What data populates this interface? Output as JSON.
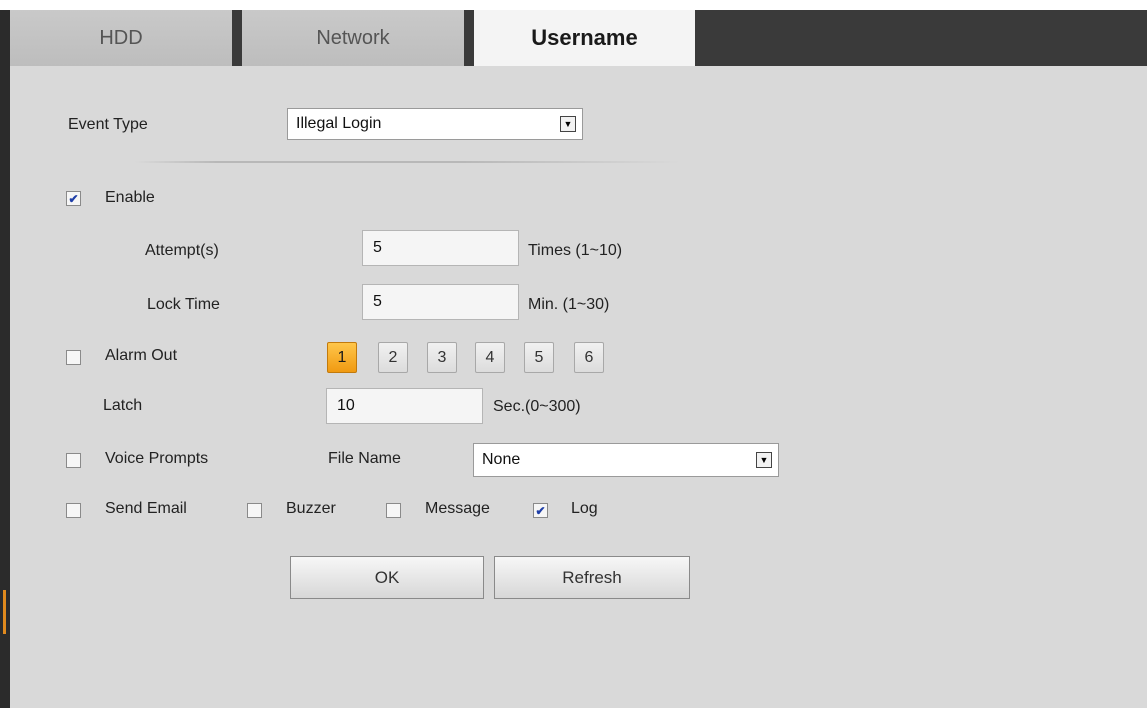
{
  "tabs": [
    {
      "label": "HDD",
      "active": false
    },
    {
      "label": "Network",
      "active": false
    },
    {
      "label": "Username",
      "active": true
    }
  ],
  "event_type": {
    "label": "Event Type",
    "value": "Illegal Login"
  },
  "enable": {
    "label": "Enable",
    "checked": true
  },
  "attempts": {
    "label": "Attempt(s)",
    "value": "5",
    "unit": "Times (1~10)"
  },
  "lock_time": {
    "label": "Lock Time",
    "value": "5",
    "unit": "Min. (1~30)"
  },
  "alarm_out": {
    "label": "Alarm Out",
    "checked": false,
    "channels": [
      "1",
      "2",
      "3",
      "4",
      "5",
      "6"
    ],
    "selected": "1"
  },
  "latch": {
    "label": "Latch",
    "value": "10",
    "unit": "Sec.(0~300)"
  },
  "voice_prompts": {
    "label": "Voice Prompts",
    "checked": false,
    "file_name_label": "File Name",
    "file_name_value": "None"
  },
  "send_email": {
    "label": "Send Email",
    "checked": false
  },
  "buzzer": {
    "label": "Buzzer",
    "checked": false
  },
  "message": {
    "label": "Message",
    "checked": false
  },
  "log": {
    "label": "Log",
    "checked": true
  },
  "buttons": {
    "ok": "OK",
    "refresh": "Refresh"
  },
  "colors": {
    "active_channel": "#f5a623",
    "tab_bar": "#3a3a3a",
    "panel": "#d9d9d9",
    "checkmark": "#1f3fa8"
  },
  "icons": {
    "checked": "checkmark-icon",
    "dropdown": "dropdown-arrow-icon"
  }
}
